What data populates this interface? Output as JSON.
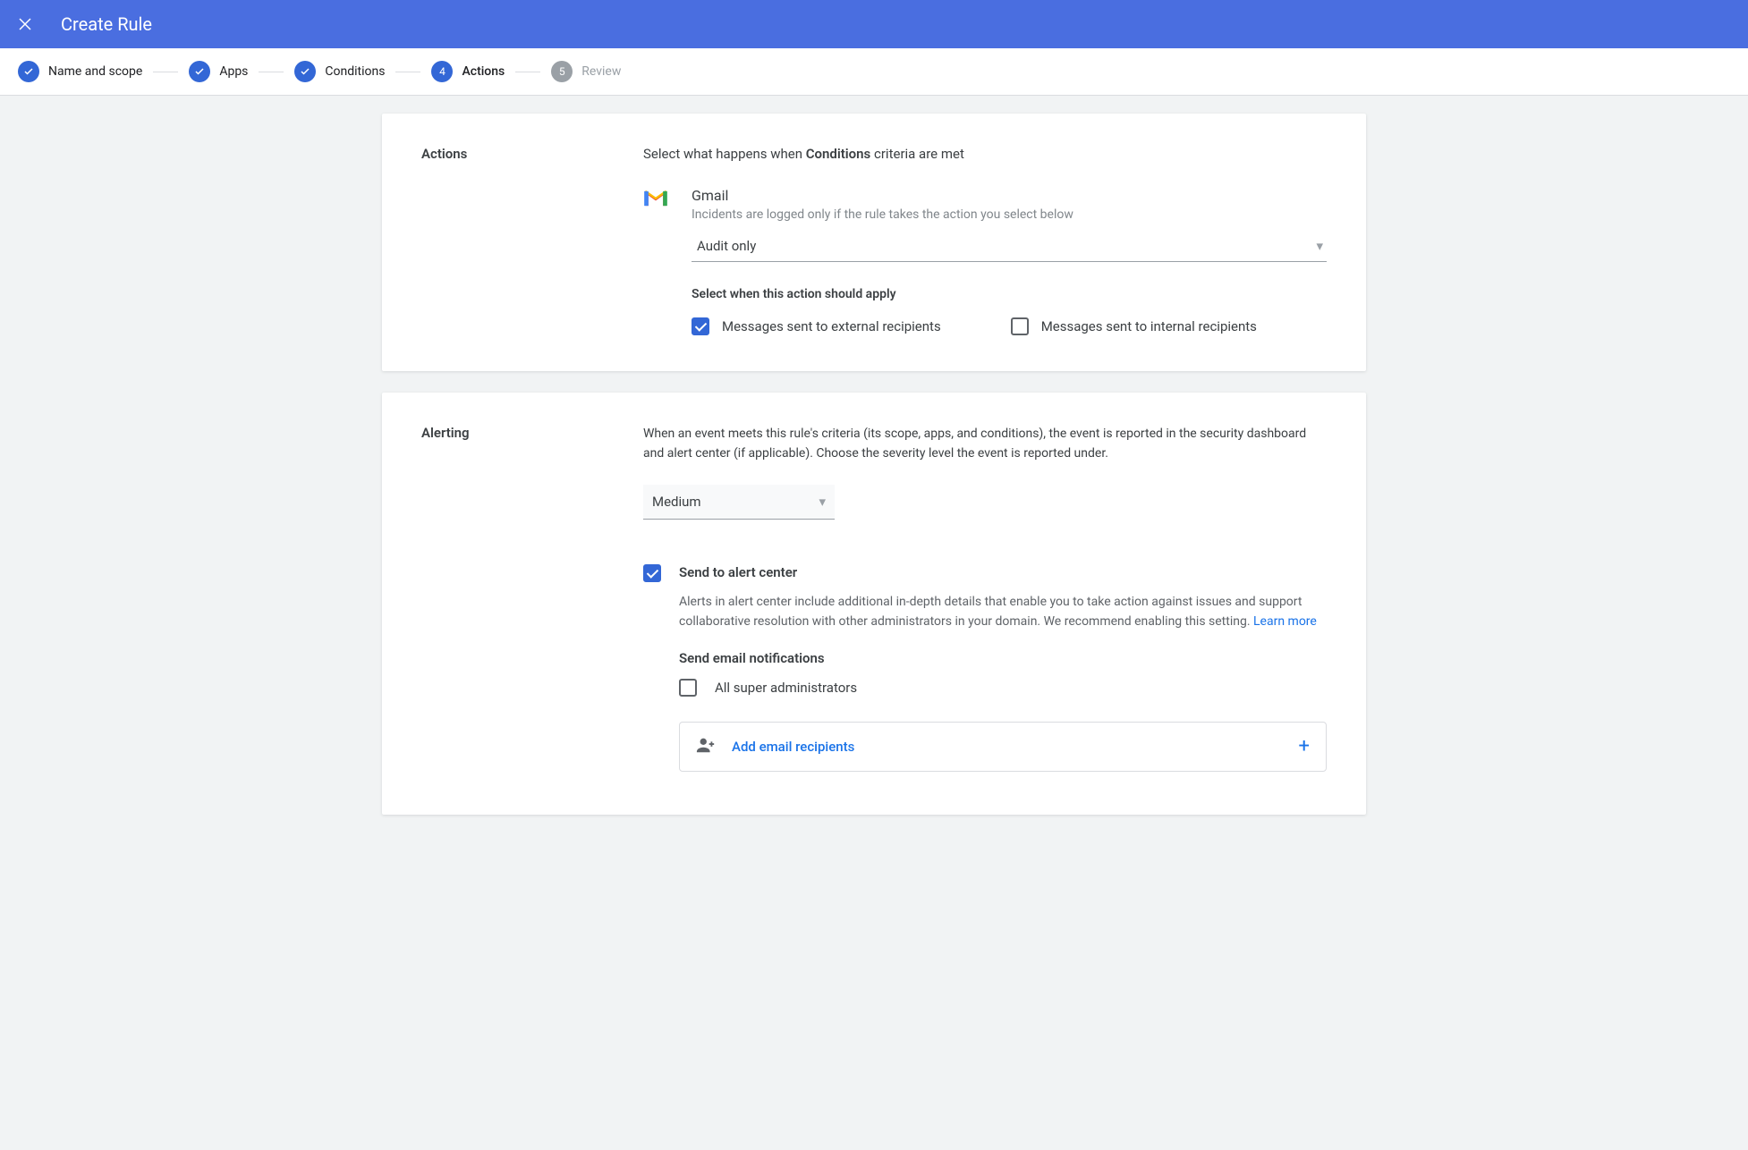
{
  "header": {
    "title": "Create Rule"
  },
  "stepper": {
    "steps": [
      {
        "num": "1",
        "label": "Name and scope",
        "state": "done"
      },
      {
        "num": "2",
        "label": "Apps",
        "state": "done"
      },
      {
        "num": "3",
        "label": "Conditions",
        "state": "done"
      },
      {
        "num": "4",
        "label": "Actions",
        "state": "active"
      },
      {
        "num": "5",
        "label": "Review",
        "state": "pending"
      }
    ]
  },
  "actions_card": {
    "title": "Actions",
    "intro_pre": "Select what happens when ",
    "intro_bold": "Conditions",
    "intro_post": " criteria are met",
    "gmail": {
      "title": "Gmail",
      "subtitle": "Incidents are logged only if the rule takes the action you select below",
      "select_value": "Audit only",
      "apply_heading": "Select when this action should apply",
      "cb_external": {
        "checked": true,
        "label": "Messages sent to external recipients"
      },
      "cb_internal": {
        "checked": false,
        "label": "Messages sent to internal recipients"
      }
    }
  },
  "alerting_card": {
    "title": "Alerting",
    "description": "When an event meets this rule's criteria (its scope, apps, and conditions), the event is reported in the security dashboard and alert center (if applicable). Choose the severity level the event is reported under.",
    "severity_value": "Medium",
    "send_alert": {
      "checked": true,
      "title": "Send to alert center",
      "description": "Alerts in alert center include additional in-depth details that enable you to take action against issues and support collaborative resolution with other administrators in your domain. We recommend enabling this setting. ",
      "learn_more": "Learn more"
    },
    "email_notifications_heading": "Send email notifications",
    "cb_super_admins": {
      "checked": false,
      "label": "All super administrators"
    },
    "add_recipients_label": "Add email recipients"
  }
}
